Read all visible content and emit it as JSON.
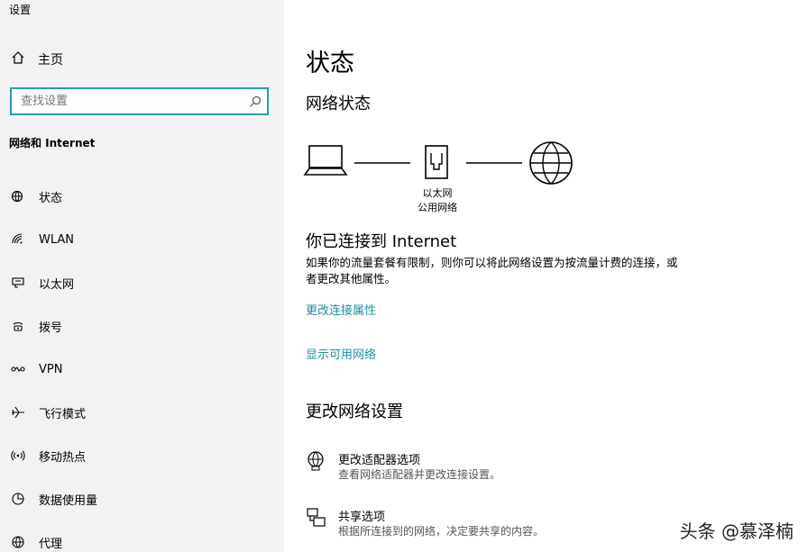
{
  "window": {
    "title": "设置"
  },
  "sidebar": {
    "home_label": "主页",
    "search_placeholder": "查找设置",
    "section_label": "网络和 Internet",
    "items": [
      {
        "label": "状态",
        "icon": "home-status-icon"
      },
      {
        "label": "WLAN",
        "icon": "wifi-icon"
      },
      {
        "label": "以太网",
        "icon": "ethernet-icon"
      },
      {
        "label": "拨号",
        "icon": "dialup-icon"
      },
      {
        "label": "VPN",
        "icon": "vpn-icon"
      },
      {
        "label": "飞行模式",
        "icon": "airplane-icon"
      },
      {
        "label": "移动热点",
        "icon": "hotspot-icon"
      },
      {
        "label": "数据使用量",
        "icon": "data-usage-icon"
      },
      {
        "label": "代理",
        "icon": "globe-icon"
      }
    ]
  },
  "main": {
    "title": "状态",
    "network_status_heading": "网络状态",
    "diagram": {
      "adapter_name": "以太网",
      "network_type": "公用网络"
    },
    "connected_heading": "你已连接到 Internet",
    "description": "如果你的流量套餐有限制，则你可以将此网络设置为按流量计费的连接，或者更改其他属性。",
    "link_change_properties": "更改连接属性",
    "link_show_networks": "显示可用网络",
    "change_settings_heading": "更改网络设置",
    "options": [
      {
        "title": "更改适配器选项",
        "desc": "查看网络适配器并更改连接设置。",
        "icon": "adapter-globe-icon"
      },
      {
        "title": "共享选项",
        "desc": "根据所连接到的网络，决定要共享的内容。",
        "icon": "sharing-icon"
      }
    ]
  },
  "watermark": "头条 @慕泽楠",
  "colors": {
    "accent": "#1a8fa8",
    "search_border": "#2a9bb0",
    "sidebar_bg": "#f2f2f2"
  }
}
